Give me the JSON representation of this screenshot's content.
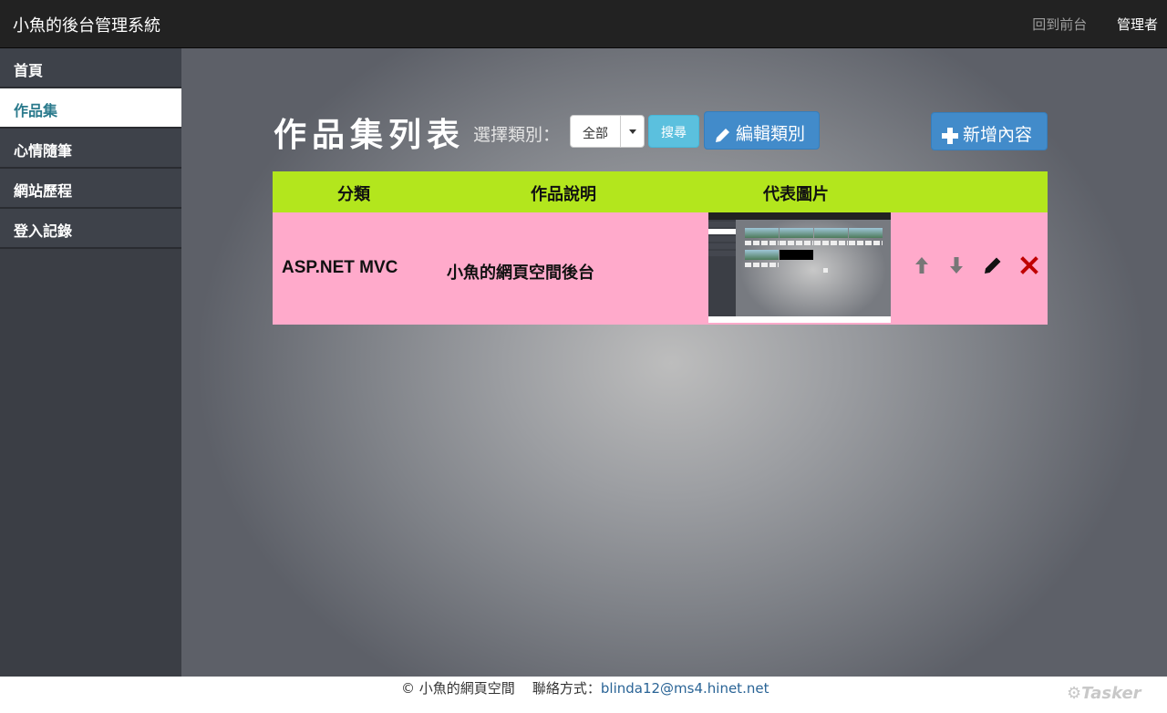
{
  "navbar": {
    "brand": "小魚的後台管理系統",
    "front_link": "回到前台",
    "admin_link": "管理者"
  },
  "sidebar": {
    "items": [
      {
        "label": "首頁",
        "active": false
      },
      {
        "label": "作品集",
        "active": true
      },
      {
        "label": "心情隨筆",
        "active": false
      },
      {
        "label": "網站歷程",
        "active": false
      },
      {
        "label": "登入記錄",
        "active": false
      }
    ]
  },
  "main": {
    "title": "作品集列表",
    "filter_label": "選擇類別：",
    "filter_selected": "全部",
    "search_label": "搜尋",
    "edit_category_label": "編輯類別",
    "add_content_label": "新增內容"
  },
  "table": {
    "headers": [
      "分類",
      "作品說明",
      "代表圖片"
    ],
    "rows": [
      {
        "category": "ASP.NET MVC",
        "description": "小魚的網頁空間後台"
      }
    ]
  },
  "footer": {
    "copyright": "© 小魚的網頁空間",
    "contact_label": "聯絡方式：",
    "email": "blinda12@ms4.hinet.net",
    "watermark": "Tasker"
  },
  "icons": {
    "edit": "pencil-icon",
    "add": "plus-icon",
    "up": "arrow-up-icon",
    "down": "arrow-down-icon",
    "delete": "close-icon"
  },
  "colors": {
    "navbar": "#222222",
    "sidebar": "#3b3e45",
    "table_header": "#b3e61d",
    "table_row": "#ffaacb",
    "primary": "#428bca",
    "info": "#5bc0de",
    "delete": "#c00000",
    "link": "#2a6496"
  }
}
